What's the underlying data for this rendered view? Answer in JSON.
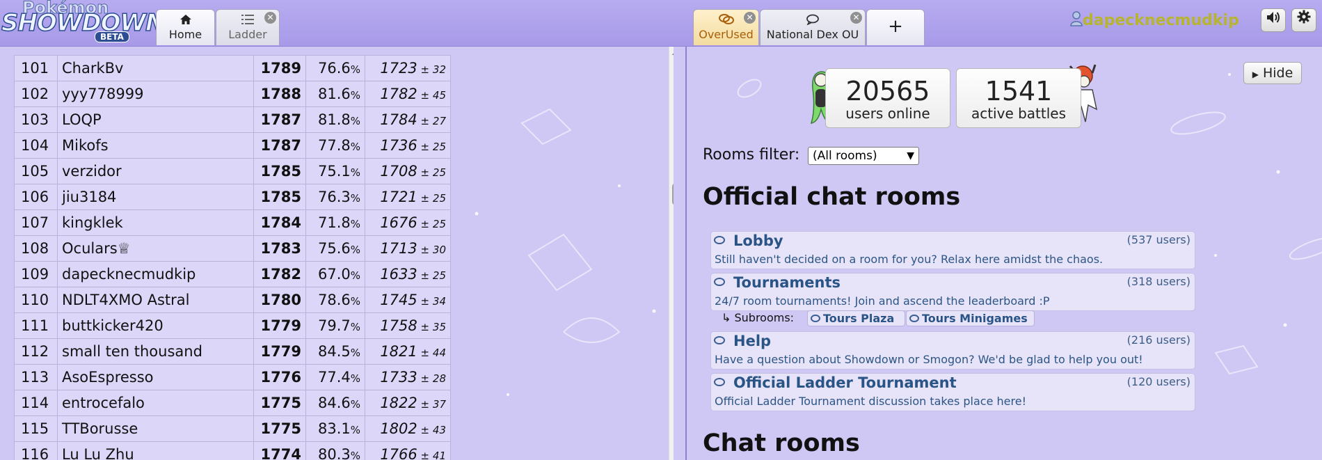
{
  "header": {
    "logo": {
      "line1": "Pokémon",
      "line2": "SHOWDOWN!",
      "badge": "BETA"
    },
    "tabs": [
      {
        "icon": "home-icon",
        "label": "Home"
      },
      {
        "icon": "list-icon",
        "label": "Ladder"
      },
      {
        "icon": "chat-icon",
        "label": "OverUsed"
      },
      {
        "icon": "chat-icon",
        "label": "National Dex OU"
      }
    ],
    "new_tab_label": "+",
    "username": "dapecknecmudkip",
    "sound_icon": "volume-icon",
    "settings_icon": "gear-icon"
  },
  "ladder": {
    "rows": [
      {
        "rank": "101",
        "name": "CharkBv",
        "elo": "1789",
        "gxe": "76.6",
        "glicko": "1723",
        "dev": "32"
      },
      {
        "rank": "102",
        "name": "yyy778999",
        "elo": "1788",
        "gxe": "81.6",
        "glicko": "1782",
        "dev": "45"
      },
      {
        "rank": "103",
        "name": "LOQP",
        "elo": "1787",
        "gxe": "81.8",
        "glicko": "1784",
        "dev": "27"
      },
      {
        "rank": "104",
        "name": "Mikofs",
        "elo": "1787",
        "gxe": "77.8",
        "glicko": "1736",
        "dev": "25"
      },
      {
        "rank": "105",
        "name": "verzidor",
        "elo": "1785",
        "gxe": "75.1",
        "glicko": "1708",
        "dev": "25"
      },
      {
        "rank": "106",
        "name": "jiu3184",
        "elo": "1785",
        "gxe": "76.3",
        "glicko": "1721",
        "dev": "25"
      },
      {
        "rank": "107",
        "name": "kingklek",
        "elo": "1784",
        "gxe": "71.8",
        "glicko": "1676",
        "dev": "25"
      },
      {
        "rank": "108",
        "name": "Oculars♕",
        "elo": "1783",
        "gxe": "75.6",
        "glicko": "1713",
        "dev": "30"
      },
      {
        "rank": "109",
        "name": "dapecknecmudkip",
        "elo": "1782",
        "gxe": "67.0",
        "glicko": "1633",
        "dev": "25"
      },
      {
        "rank": "110",
        "name": "NDLT4XMO Astral",
        "elo": "1780",
        "gxe": "78.6",
        "glicko": "1745",
        "dev": "34"
      },
      {
        "rank": "111",
        "name": "buttkicker420",
        "elo": "1779",
        "gxe": "79.7",
        "glicko": "1758",
        "dev": "35"
      },
      {
        "rank": "112",
        "name": "small ten thousand",
        "elo": "1779",
        "gxe": "84.5",
        "glicko": "1821",
        "dev": "44"
      },
      {
        "rank": "113",
        "name": "AsoEspresso",
        "elo": "1776",
        "gxe": "77.4",
        "glicko": "1733",
        "dev": "28"
      },
      {
        "rank": "114",
        "name": "entrocefalo",
        "elo": "1775",
        "gxe": "84.6",
        "glicko": "1822",
        "dev": "37"
      },
      {
        "rank": "115",
        "name": "TTBorusse",
        "elo": "1775",
        "gxe": "83.1",
        "glicko": "1802",
        "dev": "43"
      },
      {
        "rank": "116",
        "name": "Lu Lu Zhu",
        "elo": "1774",
        "gxe": "80.3",
        "glicko": "1766",
        "dev": "41"
      }
    ],
    "percent_sign": "%",
    "pm_sign": "±"
  },
  "stats": {
    "users_online": "20565",
    "users_online_label": "users online",
    "active_battles": "1541",
    "active_battles_label": "active battles"
  },
  "hide_label": "Hide",
  "rooms_filter": {
    "label": "Rooms filter:",
    "value": "(All rooms)"
  },
  "official_heading": "Official chat rooms",
  "official_rooms": [
    {
      "name": "Lobby",
      "users": "(537 users)",
      "desc": "Still haven't decided on a room for you? Relax here amidst the chaos."
    },
    {
      "name": "Tournaments",
      "users": "(318 users)",
      "desc": "24/7 room tournaments! Join and ascend the leaderboard :P"
    },
    {
      "name": "Help",
      "users": "(216 users)",
      "desc": "Have a question about Showdown or Smogon? We'd be glad to help you out!"
    },
    {
      "name": "Official Ladder Tournament",
      "users": "(120 users)",
      "desc": "Official Ladder Tournament discussion takes place here!"
    }
  ],
  "subrooms": {
    "label": "↳ Subrooms:",
    "items": [
      "Tours Plaza",
      "Tours Minigames"
    ]
  },
  "chat_heading": "Chat rooms"
}
